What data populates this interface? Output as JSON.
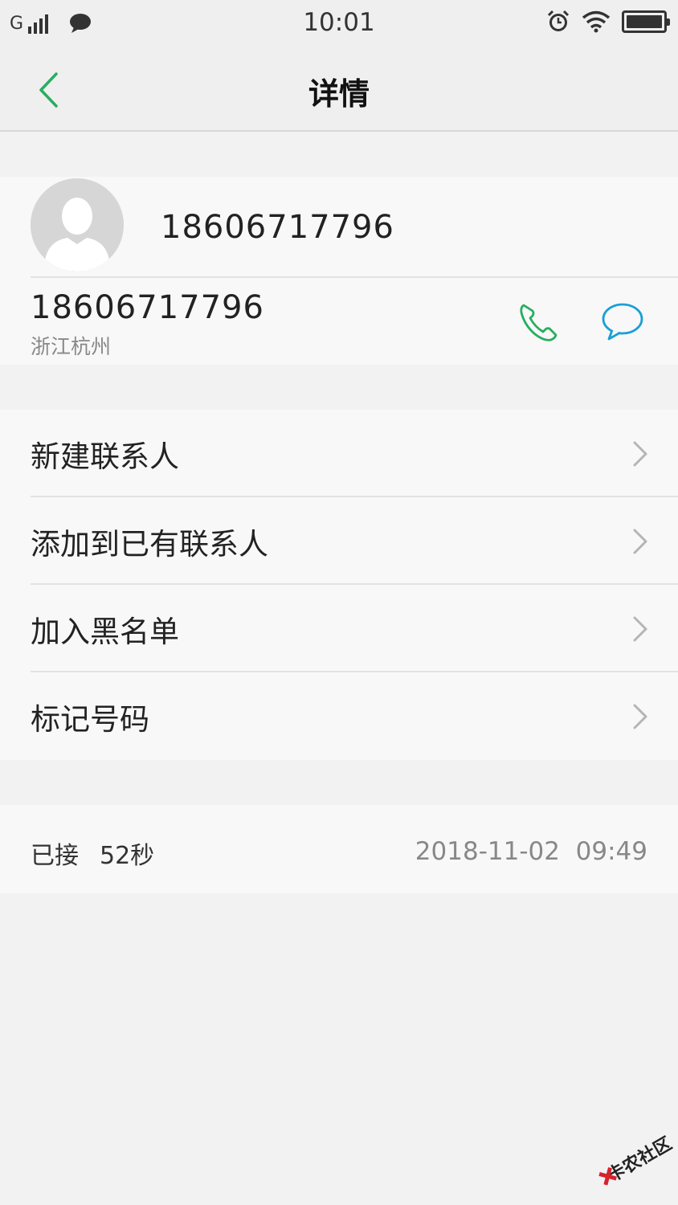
{
  "status_bar": {
    "network": "G",
    "signal_bars": 4,
    "time": "10:01",
    "battery_level": 1.0,
    "icons": [
      "signal-icon",
      "chat-notification-icon",
      "alarm-icon",
      "wifi-icon",
      "battery-icon"
    ]
  },
  "nav": {
    "title": "详情",
    "back_icon": "chevron-left-icon"
  },
  "contact": {
    "name": "18606717796",
    "number": "18606717796",
    "location": "浙江杭州",
    "avatar_icon": "default-avatar-icon",
    "call_icon": "phone-icon",
    "message_icon": "message-icon"
  },
  "menu": {
    "items": [
      {
        "label": "新建联系人"
      },
      {
        "label": "添加到已有联系人"
      },
      {
        "label": "加入黑名单"
      },
      {
        "label": "标记号码"
      }
    ]
  },
  "call_log": {
    "status": "已接",
    "duration": "52秒",
    "datetime": "2018-11-02  09:49"
  },
  "watermark": {
    "text": "卡农社区"
  },
  "colors": {
    "accent_green": "#27ae60",
    "message_blue": "#1a9fd6",
    "background": "#f2f2f2",
    "card": "#f8f8f8"
  }
}
